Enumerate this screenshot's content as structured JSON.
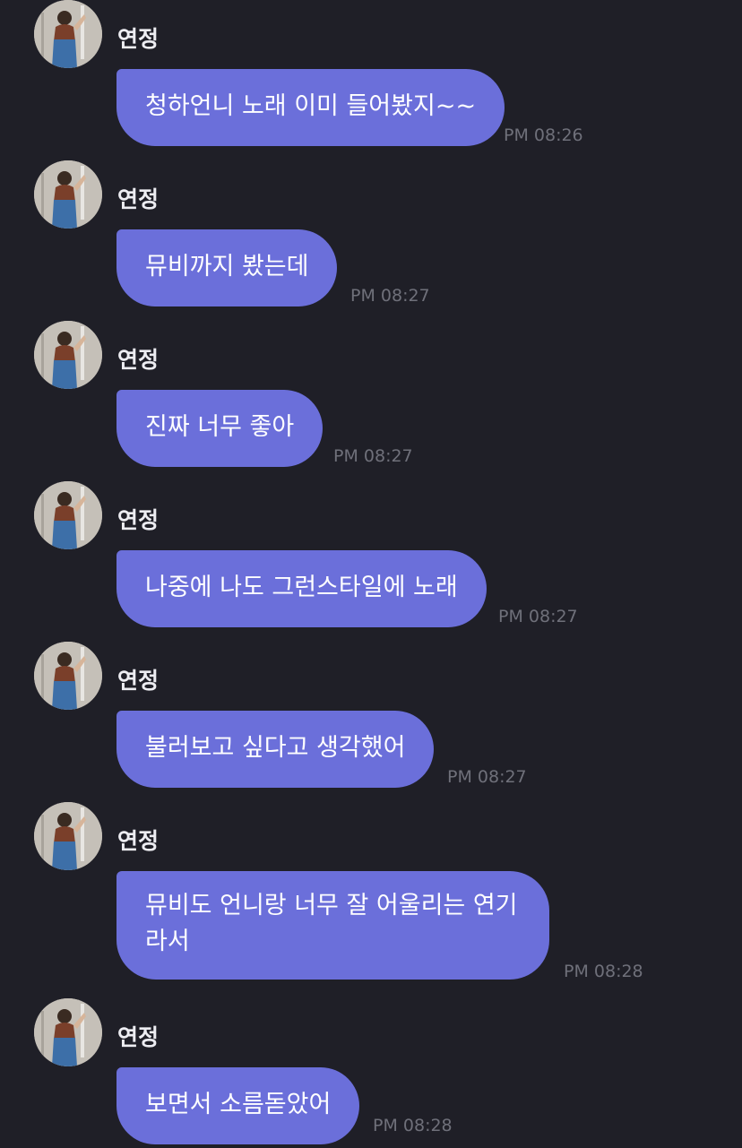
{
  "messages": [
    {
      "sender": "연정",
      "text": "청하언니 노래 이미 들어봤지~~",
      "time": "PM 08:26"
    },
    {
      "sender": "연정",
      "text": "뮤비까지 봤는데",
      "time": "PM 08:27"
    },
    {
      "sender": "연정",
      "text": "진짜 너무 좋아",
      "time": "PM 08:27"
    },
    {
      "sender": "연정",
      "text": "나중에 나도 그런스타일에 노래",
      "time": "PM 08:27"
    },
    {
      "sender": "연정",
      "text": "불러보고 싶다고 생각했어",
      "time": "PM 08:27"
    },
    {
      "sender": "연정",
      "text": "뮤비도 언니랑 너무 잘 어울리는 연기라서",
      "time": "PM 08:28"
    },
    {
      "sender": "연정",
      "text": "보면서 소름돋았어",
      "time": "PM 08:28"
    }
  ],
  "colors": {
    "background": "#1f1f27",
    "bubble": "#6b6fda",
    "name_text": "#ededf2",
    "time_text": "#6f707a"
  },
  "icons": {
    "avatar": "profile-photo-avatar"
  }
}
